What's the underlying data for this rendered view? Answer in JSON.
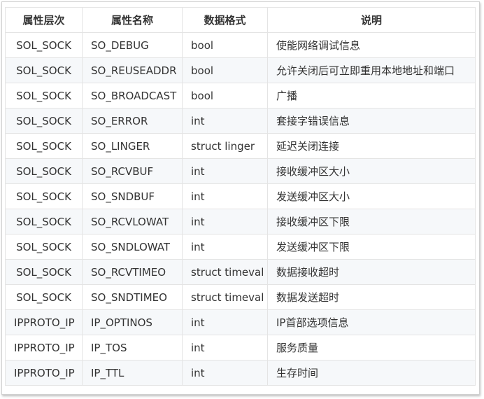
{
  "table": {
    "headers": [
      "属性层次",
      "属性名称",
      "数据格式",
      "说明"
    ],
    "rows": [
      [
        "SOL_SOCK",
        "SO_DEBUG",
        "bool",
        "使能网络调试信息"
      ],
      [
        "SOL_SOCK",
        "SO_REUSEADDR",
        "bool",
        "允许关闭后可立即重用本地地址和端口"
      ],
      [
        "SOL_SOCK",
        "SO_BROADCAST",
        "bool",
        "广播"
      ],
      [
        "SOL_SOCK",
        "SO_ERROR",
        "int",
        "套接字错误信息"
      ],
      [
        "SOL_SOCK",
        "SO_LINGER",
        "struct linger",
        "延迟关闭连接"
      ],
      [
        "SOL_SOCK",
        "SO_RCVBUF",
        "int",
        "接收缓冲区大小"
      ],
      [
        "SOL_SOCK",
        "SO_SNDBUF",
        "int",
        "发送缓冲区大小"
      ],
      [
        "SOL_SOCK",
        "SO_RCVLOWAT",
        "int",
        "接收缓冲区下限"
      ],
      [
        "SOL_SOCK",
        "SO_SNDLOWAT",
        "int",
        "发送缓冲区下限"
      ],
      [
        "SOL_SOCK",
        "SO_RCVTIMEO",
        "struct timeval",
        "数据接收超时"
      ],
      [
        "SOL_SOCK",
        "SO_SNDTIMEO",
        "struct timeval",
        "数据发送超时"
      ],
      [
        "IPPROTO_IP",
        "IP_OPTINOS",
        "int",
        "IP首部选项信息"
      ],
      [
        "IPPROTO_IP",
        "IP_TOS",
        "int",
        "服务质量"
      ],
      [
        "IPPROTO_IP",
        "IP_TTL",
        "int",
        "生存时间"
      ]
    ]
  }
}
